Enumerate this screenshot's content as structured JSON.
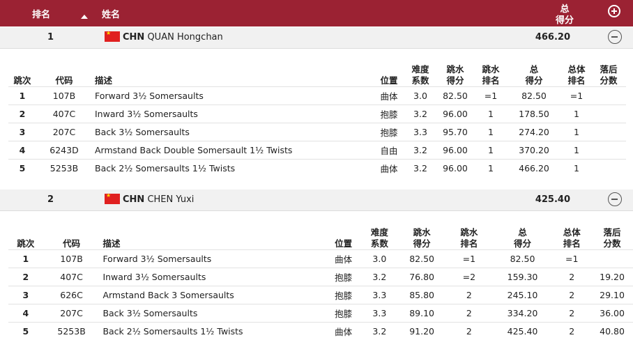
{
  "header": {
    "rank": "排名",
    "name": "姓名",
    "total_line1": "总",
    "total_line2": "得分"
  },
  "columns": {
    "no": "跳次",
    "code": "代码",
    "desc": "描述",
    "pos": "位置",
    "dd1": "难度",
    "dd2": "系数",
    "score1": "跳水",
    "score2": "得分",
    "drank1": "跳水",
    "drank2": "排名",
    "total1": "总",
    "total2": "得分",
    "orank1": "总体",
    "orank2": "排名",
    "behind1": "落后",
    "behind2": "分数"
  },
  "athletes": [
    {
      "rank": "1",
      "country": "CHN",
      "name": "QUAN Hongchan",
      "total": "466.20",
      "dives": [
        {
          "no": "1",
          "code": "107B",
          "desc": "Forward 3½ Somersaults",
          "pos": "曲体",
          "dd": "3.0",
          "score": "82.50",
          "drank": "=1",
          "total": "82.50",
          "orank": "=1",
          "behind": ""
        },
        {
          "no": "2",
          "code": "407C",
          "desc": "Inward 3½ Somersaults",
          "pos": "抱膝",
          "dd": "3.2",
          "score": "96.00",
          "drank": "1",
          "total": "178.50",
          "orank": "1",
          "behind": ""
        },
        {
          "no": "3",
          "code": "207C",
          "desc": "Back 3½ Somersaults",
          "pos": "抱膝",
          "dd": "3.3",
          "score": "95.70",
          "drank": "1",
          "total": "274.20",
          "orank": "1",
          "behind": ""
        },
        {
          "no": "4",
          "code": "6243D",
          "desc": "Armstand Back Double Somersault 1½ Twists",
          "pos": "自由",
          "dd": "3.2",
          "score": "96.00",
          "drank": "1",
          "total": "370.20",
          "orank": "1",
          "behind": ""
        },
        {
          "no": "5",
          "code": "5253B",
          "desc": "Back 2½ Somersaults 1½ Twists",
          "pos": "曲体",
          "dd": "3.2",
          "score": "96.00",
          "drank": "1",
          "total": "466.20",
          "orank": "1",
          "behind": ""
        }
      ]
    },
    {
      "rank": "2",
      "country": "CHN",
      "name": "CHEN Yuxi",
      "total": "425.40",
      "dives": [
        {
          "no": "1",
          "code": "107B",
          "desc": "Forward 3½ Somersaults",
          "pos": "曲体",
          "dd": "3.0",
          "score": "82.50",
          "drank": "=1",
          "total": "82.50",
          "orank": "=1",
          "behind": ""
        },
        {
          "no": "2",
          "code": "407C",
          "desc": "Inward 3½ Somersaults",
          "pos": "抱膝",
          "dd": "3.2",
          "score": "76.80",
          "drank": "=2",
          "total": "159.30",
          "orank": "2",
          "behind": "19.20"
        },
        {
          "no": "3",
          "code": "626C",
          "desc": "Armstand Back 3 Somersaults",
          "pos": "抱膝",
          "dd": "3.3",
          "score": "85.80",
          "drank": "2",
          "total": "245.10",
          "orank": "2",
          "behind": "29.10"
        },
        {
          "no": "4",
          "code": "207C",
          "desc": "Back 3½ Somersaults",
          "pos": "抱膝",
          "dd": "3.3",
          "score": "89.10",
          "drank": "2",
          "total": "334.20",
          "orank": "2",
          "behind": "36.00"
        },
        {
          "no": "5",
          "code": "5253B",
          "desc": "Back 2½ Somersaults 1½ Twists",
          "pos": "曲体",
          "dd": "3.2",
          "score": "91.20",
          "drank": "2",
          "total": "425.40",
          "orank": "2",
          "behind": "40.80"
        }
      ]
    }
  ]
}
